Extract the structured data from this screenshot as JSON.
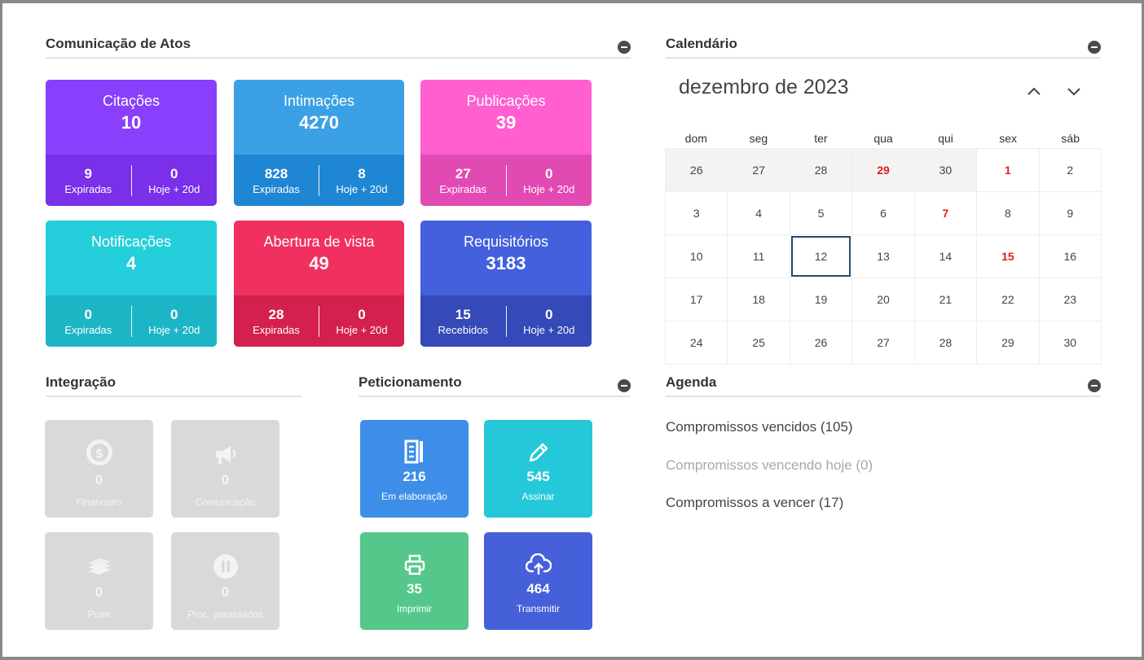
{
  "comunicacao": {
    "title": "Comunicação de Atos",
    "tiles": [
      {
        "name": "Citações",
        "count": "10",
        "left_num": "9",
        "left_label": "Expiradas",
        "right_num": "0",
        "right_label": "Hoje + 20d",
        "color_top": "#8a3ffc",
        "color_bottom": "#7a2fe8"
      },
      {
        "name": "Intimações",
        "count": "4270",
        "left_num": "828",
        "left_label": "Expiradas",
        "right_num": "8",
        "right_label": "Hoje + 20d",
        "color_top": "#3ca0e6",
        "color_bottom": "#1f86d3"
      },
      {
        "name": "Publicações",
        "count": "39",
        "left_num": "27",
        "left_label": "Expiradas",
        "right_num": "0",
        "right_label": "Hoje + 20d",
        "color_top": "#ff5fcf",
        "color_bottom": "#e24ab3"
      },
      {
        "name": "Notificações",
        "count": "4",
        "left_num": "0",
        "left_label": "Expiradas",
        "right_num": "0",
        "right_label": "Hoje + 20d",
        "color_top": "#25cedb",
        "color_bottom": "#1cb5c5"
      },
      {
        "name": "Abertura de vista",
        "count": "49",
        "left_num": "28",
        "left_label": "Expiradas",
        "right_num": "0",
        "right_label": "Hoje + 20d",
        "color_top": "#f0305f",
        "color_bottom": "#d4204c"
      },
      {
        "name": "Requisitórios",
        "count": "3183",
        "left_num": "15",
        "left_label": "Recebidos",
        "right_num": "0",
        "right_label": "Hoje + 20d",
        "color_top": "#4460dc",
        "color_bottom": "#3549b8"
      }
    ]
  },
  "integracao": {
    "title": "Integração",
    "tiles": [
      {
        "num": "0",
        "label": "Financeiro",
        "icon": "dollar-icon"
      },
      {
        "num": "0",
        "label": "Comunicação",
        "icon": "megaphone-icon"
      },
      {
        "num": "0",
        "label": "Push",
        "icon": "papers-icon"
      },
      {
        "num": "0",
        "label": "Proc. paralisados",
        "icon": "pause-icon"
      }
    ]
  },
  "peticionamento": {
    "title": "Peticionamento",
    "tiles": [
      {
        "num": "216",
        "label": "Em elaboração",
        "icon": "document-edit-icon",
        "color": "#3d8ee8"
      },
      {
        "num": "545",
        "label": "Assinar",
        "icon": "pencil-icon",
        "color": "#25c8d8"
      },
      {
        "num": "35",
        "label": "Imprimir",
        "icon": "printer-icon",
        "color": "#55c78a"
      },
      {
        "num": "464",
        "label": "Transmitir",
        "icon": "cloud-upload-icon",
        "color": "#4560d8"
      }
    ]
  },
  "calendario": {
    "title": "Calendário",
    "month_label": "dezembro de 2023",
    "weekdays": [
      "dom",
      "seg",
      "ter",
      "qua",
      "qui",
      "sex",
      "sáb"
    ],
    "weeks": [
      [
        "26",
        "27",
        "28",
        "29",
        "30",
        "1",
        "2"
      ],
      [
        "3",
        "4",
        "5",
        "6",
        "7",
        "8",
        "9"
      ],
      [
        "10",
        "11",
        "12",
        "13",
        "14",
        "15",
        "16"
      ],
      [
        "17",
        "18",
        "19",
        "20",
        "21",
        "22",
        "23"
      ],
      [
        "24",
        "25",
        "26",
        "27",
        "28",
        "29",
        "30"
      ]
    ],
    "other_month_cells": [
      "0-0",
      "0-1",
      "0-2",
      "0-3",
      "0-4"
    ],
    "holiday_cells": [
      "0-3",
      "0-5",
      "1-4",
      "2-5"
    ],
    "today_cell": "2-2"
  },
  "agenda": {
    "title": "Agenda",
    "items": [
      {
        "label": "Compromissos vencidos (105)",
        "muted": false
      },
      {
        "label": "Compromissos vencendo hoje (0)",
        "muted": true
      },
      {
        "label": "Compromissos a vencer (17)",
        "muted": false
      }
    ]
  }
}
